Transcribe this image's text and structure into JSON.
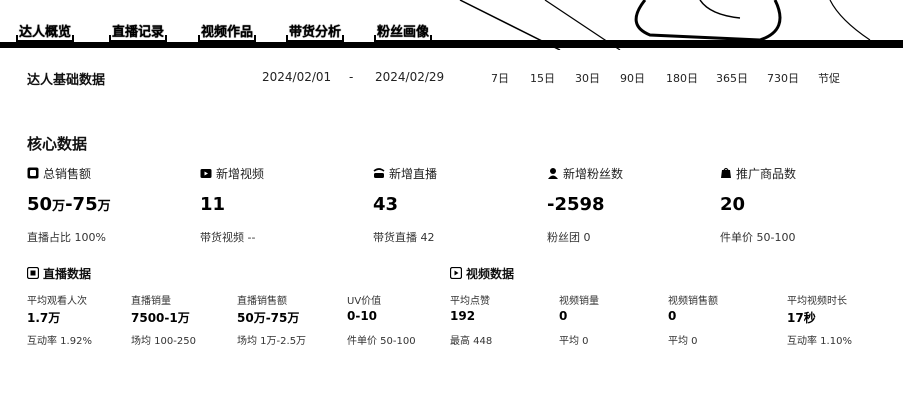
{
  "tabs": [
    {
      "label": "达人概览",
      "active": true
    },
    {
      "label": "直播记录",
      "active": false
    },
    {
      "label": "视频作品",
      "active": false
    },
    {
      "label": "带货分析",
      "active": false
    },
    {
      "label": "粉丝画像",
      "active": false
    }
  ],
  "basic": {
    "title": "达人基础数据",
    "date_start": "2024/02/01",
    "date_sep": "-",
    "date_end": "2024/02/29",
    "ranges": [
      "7日",
      "15日",
      "30日",
      "90日",
      "180日",
      "365日",
      "730日",
      "节促"
    ]
  },
  "core": {
    "title": "核心数据",
    "metrics": [
      {
        "label": "总销售额",
        "value": "50",
        "unit1": "万",
        "value2": "-75",
        "unit2": "万",
        "sub": "直播占比 100%",
        "icon": "sales-icon"
      },
      {
        "label": "新增视频",
        "value": "11",
        "sub": "带货视频 --",
        "icon": "video-icon"
      },
      {
        "label": "新增直播",
        "value": "43",
        "sub": "带货直播 42",
        "icon": "live-icon"
      },
      {
        "label": "新增粉丝数",
        "value": "-2598",
        "sub": "粉丝团 0",
        "icon": "fans-icon"
      },
      {
        "label": "推广商品数",
        "value": "20",
        "sub": "件单价 50-100",
        "icon": "goods-icon"
      }
    ]
  },
  "live": {
    "title": "直播数据",
    "stats": [
      {
        "label": "平均观看人次",
        "value": "1.7万",
        "sub": "互动率 1.92%"
      },
      {
        "label": "直播销量",
        "value": "7500-1万",
        "sub": "场均 100-250"
      },
      {
        "label": "直播销售额",
        "value": "50万-75万",
        "sub": "场均 1万-2.5万"
      },
      {
        "label": "UV价值",
        "value": "0-10",
        "sub": "件单价 50-100"
      }
    ]
  },
  "video": {
    "title": "视频数据",
    "stats": [
      {
        "label": "平均点赞",
        "value": "192",
        "sub": "最高 448"
      },
      {
        "label": "视频销量",
        "value": "0",
        "sub": "平均 0"
      },
      {
        "label": "视频销售额",
        "value": "0",
        "sub": "平均 0"
      },
      {
        "label": "平均视频时长",
        "value": "17秒",
        "sub": "互动率 1.10%"
      }
    ]
  }
}
